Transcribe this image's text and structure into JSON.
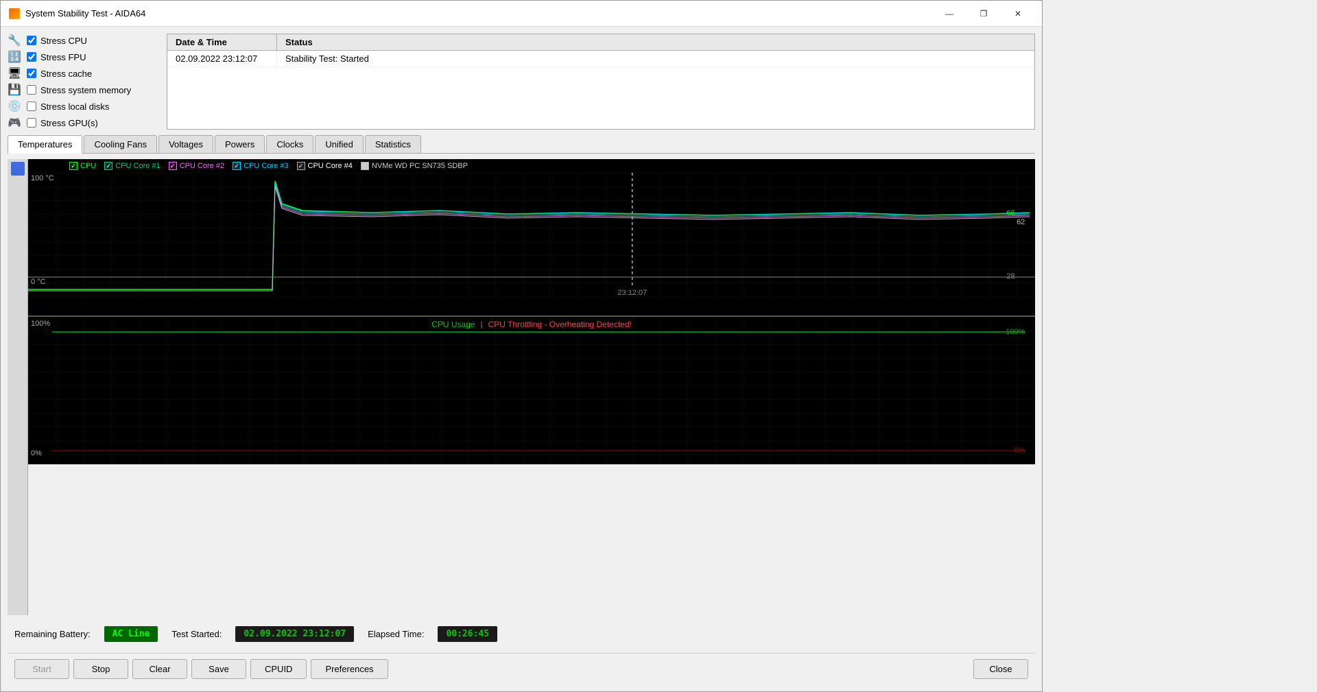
{
  "window": {
    "title": "System Stability Test - AIDA64"
  },
  "titlebar": {
    "minimize_label": "—",
    "maximize_label": "❐",
    "close_label": "✕"
  },
  "checkboxes": [
    {
      "id": "stress_cpu",
      "label": "Stress CPU",
      "checked": true,
      "icon": "🔧"
    },
    {
      "id": "stress_fpu",
      "label": "Stress FPU",
      "checked": true,
      "icon": "🔢"
    },
    {
      "id": "stress_cache",
      "label": "Stress cache",
      "checked": true,
      "icon": "🖥"
    },
    {
      "id": "stress_memory",
      "label": "Stress system memory",
      "checked": false,
      "icon": "💾"
    },
    {
      "id": "stress_disks",
      "label": "Stress local disks",
      "checked": false,
      "icon": "💿"
    },
    {
      "id": "stress_gpu",
      "label": "Stress GPU(s)",
      "checked": false,
      "icon": "🎮"
    }
  ],
  "log": {
    "columns": [
      "Date & Time",
      "Status"
    ],
    "rows": [
      {
        "datetime": "02.09.2022 23:12:07",
        "status": "Stability Test: Started"
      }
    ]
  },
  "tabs": [
    {
      "id": "temperatures",
      "label": "Temperatures",
      "active": true
    },
    {
      "id": "cooling_fans",
      "label": "Cooling Fans",
      "active": false
    },
    {
      "id": "voltages",
      "label": "Voltages",
      "active": false
    },
    {
      "id": "powers",
      "label": "Powers",
      "active": false
    },
    {
      "id": "clocks",
      "label": "Clocks",
      "active": false
    },
    {
      "id": "unified",
      "label": "Unified",
      "active": false
    },
    {
      "id": "statistics",
      "label": "Statistics",
      "active": false
    }
  ],
  "temp_chart": {
    "legend": [
      {
        "label": "CPU",
        "color": "#00ff00",
        "checked": true
      },
      {
        "label": "CPU Core #1",
        "color": "#00cc88",
        "checked": true
      },
      {
        "label": "CPU Core #2",
        "color": "#ff66ff",
        "checked": true
      },
      {
        "label": "CPU Core #3",
        "color": "#00ccff",
        "checked": true
      },
      {
        "label": "CPU Core #4",
        "color": "#ffffff",
        "checked": true
      },
      {
        "label": "NVMe WD PC SN735 SDBP",
        "color": "#cccccc",
        "checked": true
      }
    ],
    "y_max": "100°C",
    "y_min": "0°C",
    "x_label": "23:12:07",
    "right_value_1": "66",
    "right_value_2": "62",
    "bottom_value": "28"
  },
  "usage_chart": {
    "title_left": "CPU Usage",
    "title_separator": "|",
    "title_right": "CPU Throttling - Overheating Detected!",
    "title_right_color": "#ff4444",
    "y_top": "100%",
    "y_bottom": "0%",
    "right_value": "100%",
    "right_value_bottom": "0%"
  },
  "bottom_info": {
    "remaining_label": "Remaining Battery:",
    "remaining_value": "AC Line",
    "test_started_label": "Test Started:",
    "test_started_value": "02.09.2022 23:12:07",
    "elapsed_label": "Elapsed Time:",
    "elapsed_value": "00:26:45"
  },
  "buttons": {
    "start": "Start",
    "stop": "Stop",
    "clear": "Clear",
    "save": "Save",
    "cpuid": "CPUID",
    "preferences": "Preferences",
    "close": "Close"
  }
}
